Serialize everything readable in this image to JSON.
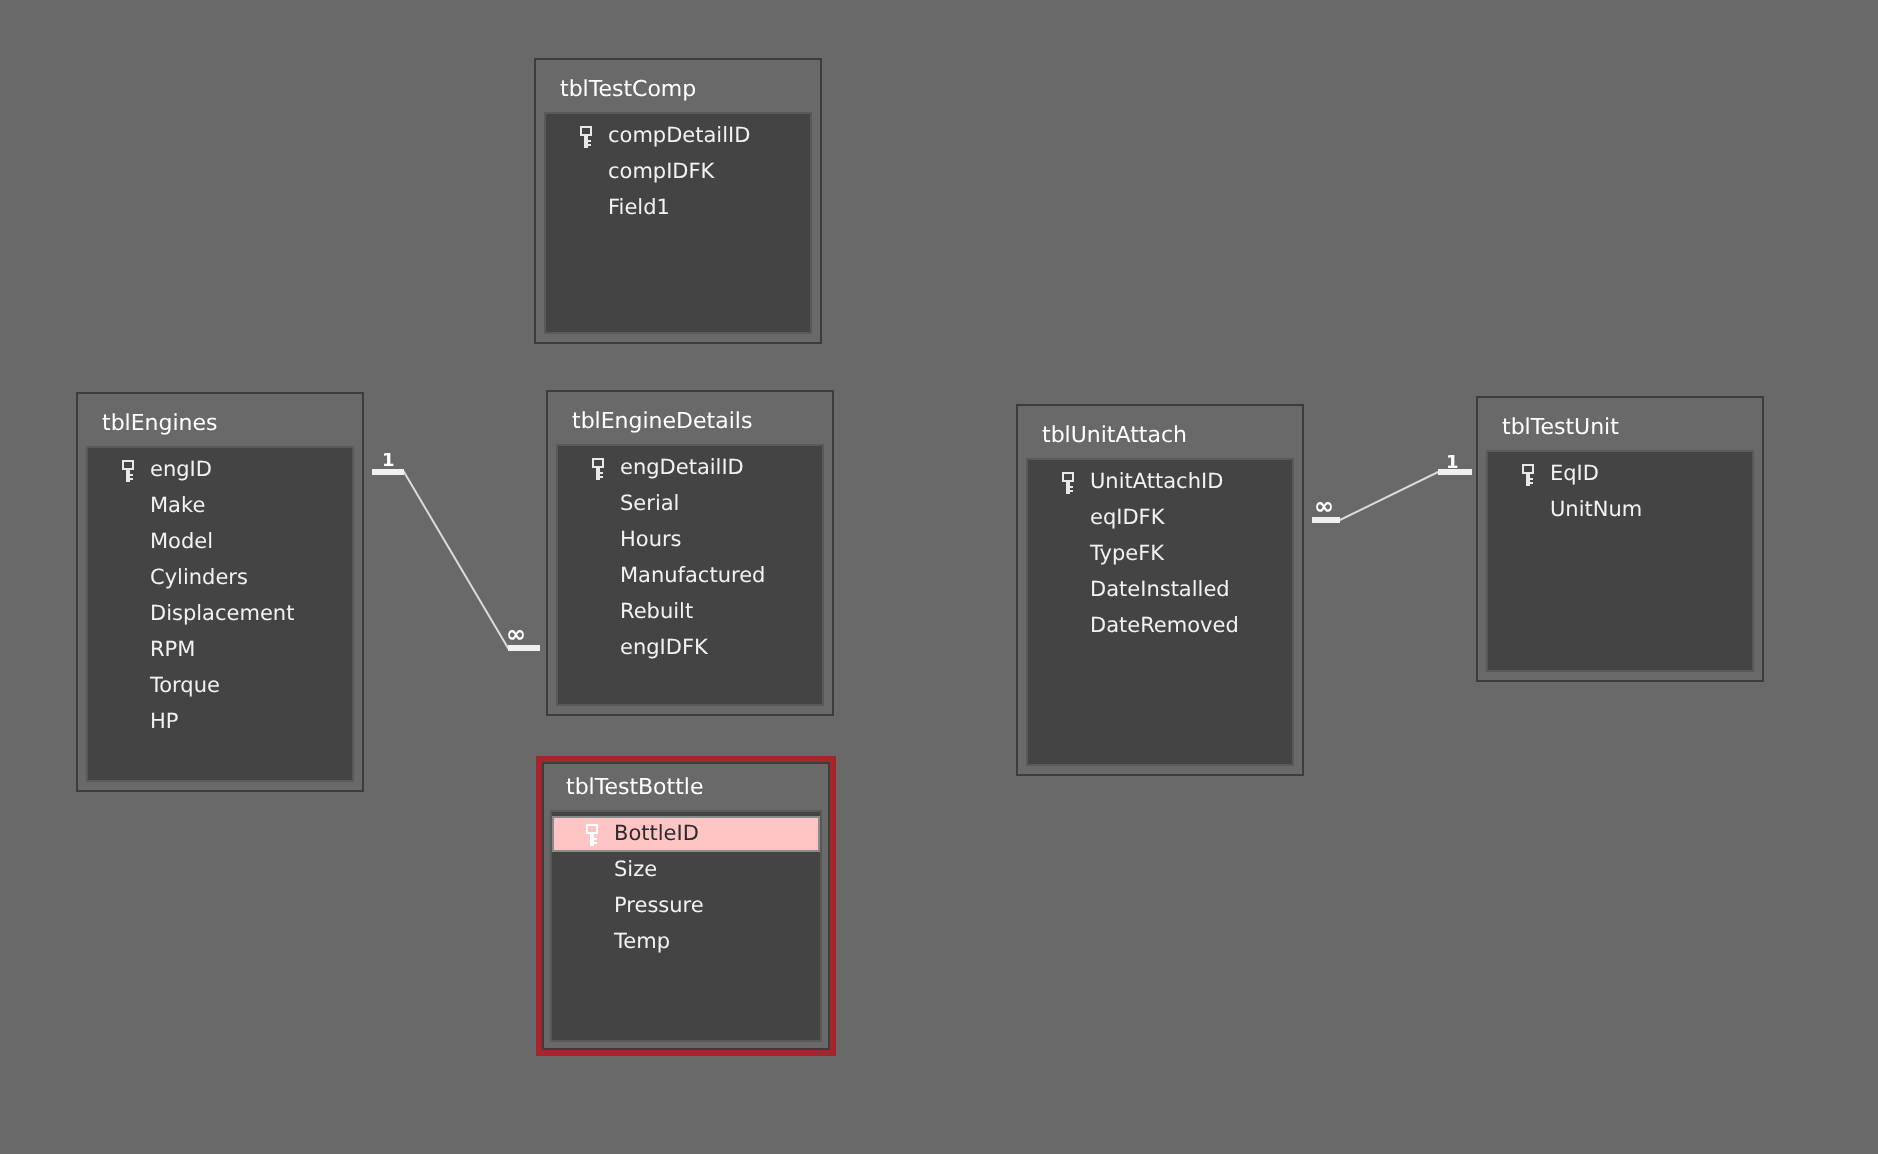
{
  "tables": [
    {
      "name": "tblTestComp",
      "selected": false,
      "fields": [
        {
          "name": "compDetailID",
          "key": true,
          "selected": false
        },
        {
          "name": "compIDFK",
          "key": false,
          "selected": false
        },
        {
          "name": "Field1",
          "key": false,
          "selected": false
        }
      ]
    },
    {
      "name": "tblEngines",
      "selected": false,
      "fields": [
        {
          "name": "engID",
          "key": true,
          "selected": false
        },
        {
          "name": "Make",
          "key": false,
          "selected": false
        },
        {
          "name": "Model",
          "key": false,
          "selected": false
        },
        {
          "name": "Cylinders",
          "key": false,
          "selected": false
        },
        {
          "name": "Displacement",
          "key": false,
          "selected": false
        },
        {
          "name": "RPM",
          "key": false,
          "selected": false
        },
        {
          "name": "Torque",
          "key": false,
          "selected": false
        },
        {
          "name": "HP",
          "key": false,
          "selected": false
        }
      ]
    },
    {
      "name": "tblEngineDetails",
      "selected": false,
      "fields": [
        {
          "name": "engDetailID",
          "key": true,
          "selected": false
        },
        {
          "name": "Serial",
          "key": false,
          "selected": false
        },
        {
          "name": "Hours",
          "key": false,
          "selected": false
        },
        {
          "name": "Manufactured",
          "key": false,
          "selected": false
        },
        {
          "name": "Rebuilt",
          "key": false,
          "selected": false
        },
        {
          "name": "engIDFK",
          "key": false,
          "selected": false
        }
      ]
    },
    {
      "name": "tblTestBottle",
      "selected": true,
      "fields": [
        {
          "name": "BottleID",
          "key": true,
          "selected": true
        },
        {
          "name": "Size",
          "key": false,
          "selected": false
        },
        {
          "name": "Pressure",
          "key": false,
          "selected": false
        },
        {
          "name": "Temp",
          "key": false,
          "selected": false
        }
      ]
    },
    {
      "name": "tblUnitAttach",
      "selected": false,
      "fields": [
        {
          "name": "UnitAttachID",
          "key": true,
          "selected": false
        },
        {
          "name": "eqIDFK",
          "key": false,
          "selected": false
        },
        {
          "name": "TypeFK",
          "key": false,
          "selected": false
        },
        {
          "name": "DateInstalled",
          "key": false,
          "selected": false
        },
        {
          "name": "DateRemoved",
          "key": false,
          "selected": false
        }
      ]
    },
    {
      "name": "tblTestUnit",
      "selected": false,
      "fields": [
        {
          "name": "EqID",
          "key": true,
          "selected": false
        },
        {
          "name": "UnitNum",
          "key": false,
          "selected": false
        }
      ]
    }
  ],
  "relationships": [
    {
      "one_label": "1",
      "many_label": "∞"
    },
    {
      "one_label": "1",
      "many_label": "∞"
    }
  ]
}
